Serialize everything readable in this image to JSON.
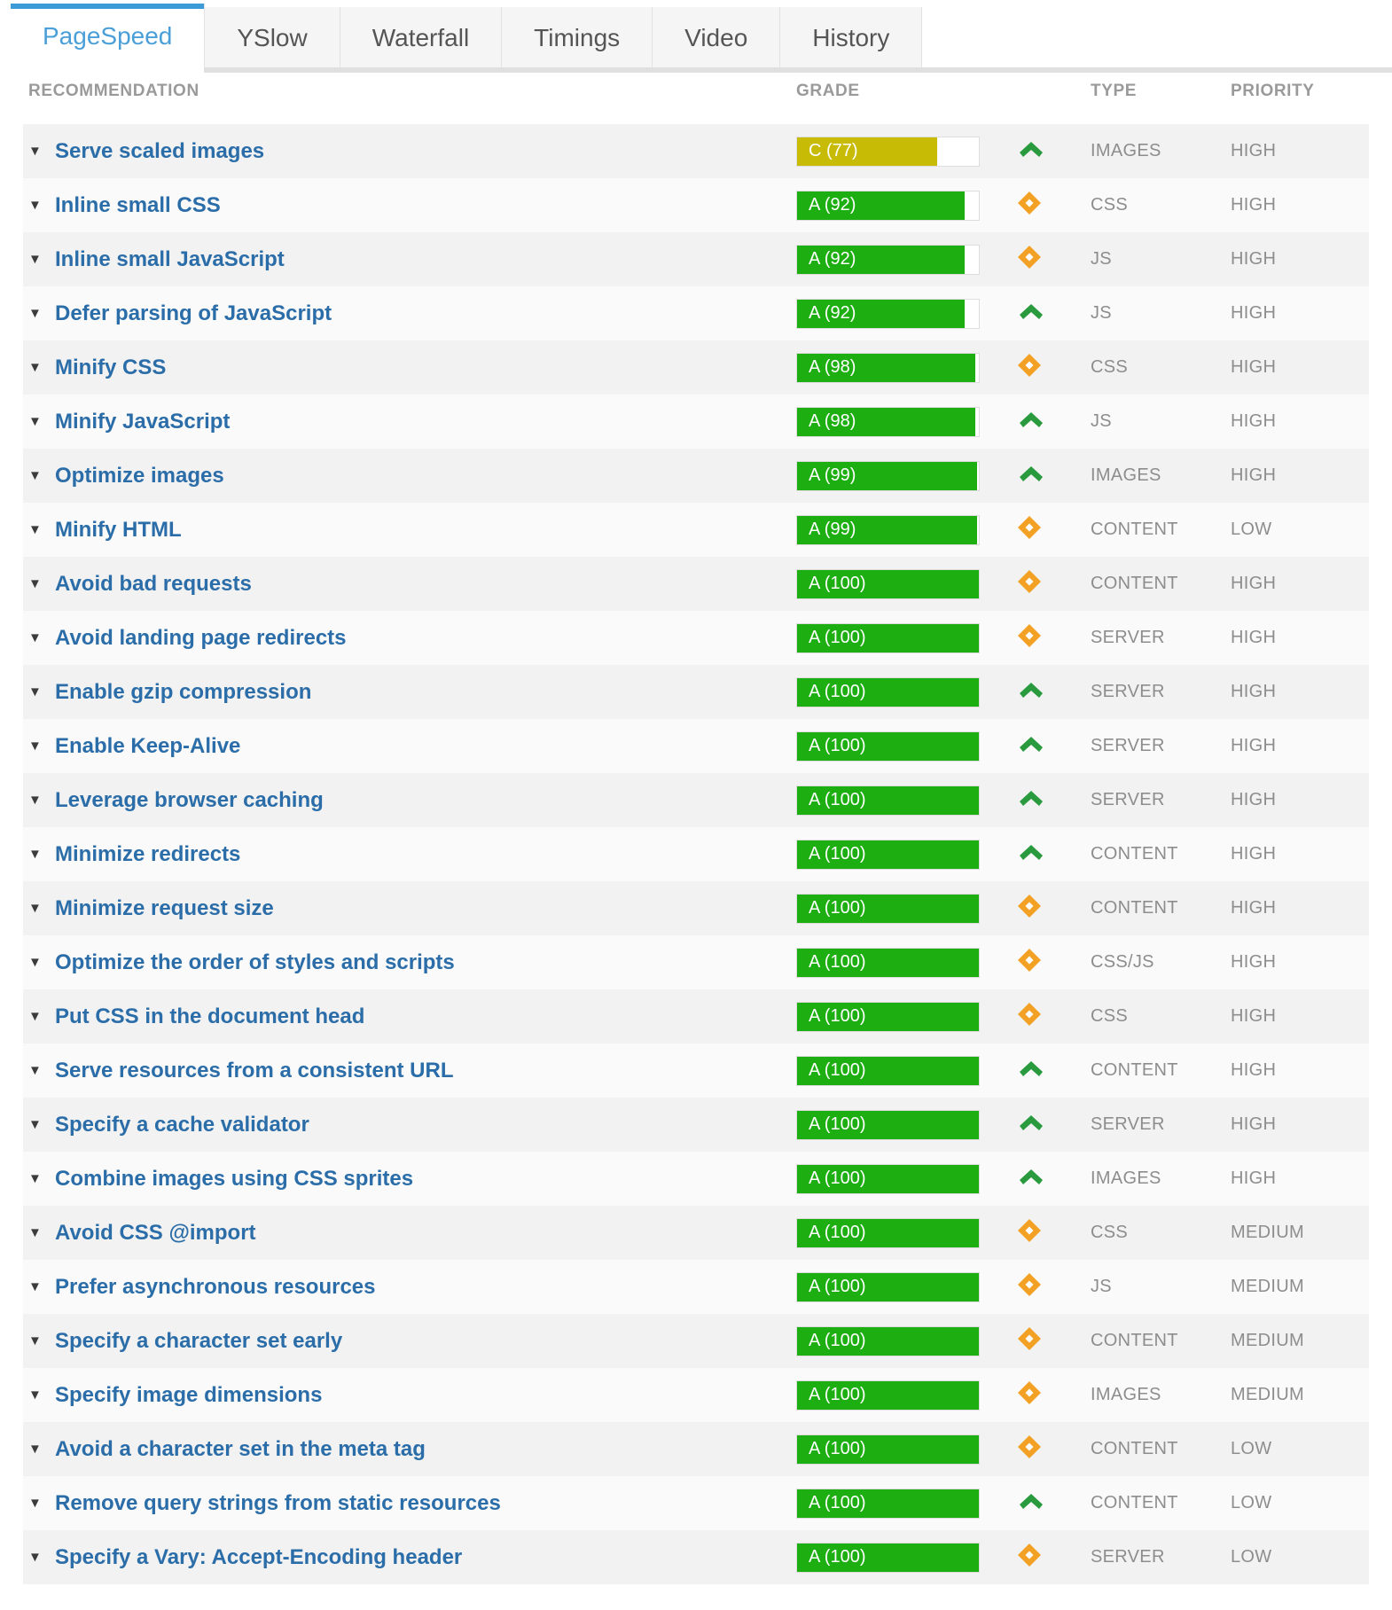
{
  "tabs": [
    {
      "label": "PageSpeed",
      "active": true
    },
    {
      "label": "YSlow",
      "active": false
    },
    {
      "label": "Waterfall",
      "active": false
    },
    {
      "label": "Timings",
      "active": false
    },
    {
      "label": "Video",
      "active": false
    },
    {
      "label": "History",
      "active": false
    }
  ],
  "columns": {
    "recommendation": "RECOMMENDATION",
    "grade": "GRADE",
    "type": "TYPE",
    "priority": "PRIORITY"
  },
  "colors": {
    "accent": "#3c9ad6",
    "link": "#2b6da8",
    "grade_green": "#1daf12",
    "grade_olive": "#c8bb06",
    "trend_up": "#2a9a3e",
    "trend_flat": "#f2a124",
    "header_text": "#9a9a9a",
    "row_odd": "#f2f2f2",
    "row_even": "#fafafa"
  },
  "toggle_glyph": "▼",
  "rows": [
    {
      "recommendation": "Serve scaled images",
      "grade": "C (77)",
      "score": 77,
      "grade_color": "olive",
      "trend": "up",
      "type": "IMAGES",
      "priority": "HIGH"
    },
    {
      "recommendation": "Inline small CSS",
      "grade": "A (92)",
      "score": 92,
      "grade_color": "green",
      "trend": "flat",
      "type": "CSS",
      "priority": "HIGH"
    },
    {
      "recommendation": "Inline small JavaScript",
      "grade": "A (92)",
      "score": 92,
      "grade_color": "green",
      "trend": "flat",
      "type": "JS",
      "priority": "HIGH"
    },
    {
      "recommendation": "Defer parsing of JavaScript",
      "grade": "A (92)",
      "score": 92,
      "grade_color": "green",
      "trend": "up",
      "type": "JS",
      "priority": "HIGH"
    },
    {
      "recommendation": "Minify CSS",
      "grade": "A (98)",
      "score": 98,
      "grade_color": "green",
      "trend": "flat",
      "type": "CSS",
      "priority": "HIGH"
    },
    {
      "recommendation": "Minify JavaScript",
      "grade": "A (98)",
      "score": 98,
      "grade_color": "green",
      "trend": "up",
      "type": "JS",
      "priority": "HIGH"
    },
    {
      "recommendation": "Optimize images",
      "grade": "A (99)",
      "score": 99,
      "grade_color": "green",
      "trend": "up",
      "type": "IMAGES",
      "priority": "HIGH"
    },
    {
      "recommendation": "Minify HTML",
      "grade": "A (99)",
      "score": 99,
      "grade_color": "green",
      "trend": "flat",
      "type": "CONTENT",
      "priority": "LOW"
    },
    {
      "recommendation": "Avoid bad requests",
      "grade": "A (100)",
      "score": 100,
      "grade_color": "green",
      "trend": "flat",
      "type": "CONTENT",
      "priority": "HIGH"
    },
    {
      "recommendation": "Avoid landing page redirects",
      "grade": "A (100)",
      "score": 100,
      "grade_color": "green",
      "trend": "flat",
      "type": "SERVER",
      "priority": "HIGH"
    },
    {
      "recommendation": "Enable gzip compression",
      "grade": "A (100)",
      "score": 100,
      "grade_color": "green",
      "trend": "up",
      "type": "SERVER",
      "priority": "HIGH"
    },
    {
      "recommendation": "Enable Keep-Alive",
      "grade": "A (100)",
      "score": 100,
      "grade_color": "green",
      "trend": "up",
      "type": "SERVER",
      "priority": "HIGH"
    },
    {
      "recommendation": "Leverage browser caching",
      "grade": "A (100)",
      "score": 100,
      "grade_color": "green",
      "trend": "up",
      "type": "SERVER",
      "priority": "HIGH"
    },
    {
      "recommendation": "Minimize redirects",
      "grade": "A (100)",
      "score": 100,
      "grade_color": "green",
      "trend": "up",
      "type": "CONTENT",
      "priority": "HIGH"
    },
    {
      "recommendation": "Minimize request size",
      "grade": "A (100)",
      "score": 100,
      "grade_color": "green",
      "trend": "flat",
      "type": "CONTENT",
      "priority": "HIGH"
    },
    {
      "recommendation": "Optimize the order of styles and scripts",
      "grade": "A (100)",
      "score": 100,
      "grade_color": "green",
      "trend": "flat",
      "type": "CSS/JS",
      "priority": "HIGH"
    },
    {
      "recommendation": "Put CSS in the document head",
      "grade": "A (100)",
      "score": 100,
      "grade_color": "green",
      "trend": "flat",
      "type": "CSS",
      "priority": "HIGH"
    },
    {
      "recommendation": "Serve resources from a consistent URL",
      "grade": "A (100)",
      "score": 100,
      "grade_color": "green",
      "trend": "up",
      "type": "CONTENT",
      "priority": "HIGH"
    },
    {
      "recommendation": "Specify a cache validator",
      "grade": "A (100)",
      "score": 100,
      "grade_color": "green",
      "trend": "up",
      "type": "SERVER",
      "priority": "HIGH"
    },
    {
      "recommendation": "Combine images using CSS sprites",
      "grade": "A (100)",
      "score": 100,
      "grade_color": "green",
      "trend": "up",
      "type": "IMAGES",
      "priority": "HIGH"
    },
    {
      "recommendation": "Avoid CSS @import",
      "grade": "A (100)",
      "score": 100,
      "grade_color": "green",
      "trend": "flat",
      "type": "CSS",
      "priority": "MEDIUM"
    },
    {
      "recommendation": "Prefer asynchronous resources",
      "grade": "A (100)",
      "score": 100,
      "grade_color": "green",
      "trend": "flat",
      "type": "JS",
      "priority": "MEDIUM"
    },
    {
      "recommendation": "Specify a character set early",
      "grade": "A (100)",
      "score": 100,
      "grade_color": "green",
      "trend": "flat",
      "type": "CONTENT",
      "priority": "MEDIUM"
    },
    {
      "recommendation": "Specify image dimensions",
      "grade": "A (100)",
      "score": 100,
      "grade_color": "green",
      "trend": "flat",
      "type": "IMAGES",
      "priority": "MEDIUM"
    },
    {
      "recommendation": "Avoid a character set in the meta tag",
      "grade": "A (100)",
      "score": 100,
      "grade_color": "green",
      "trend": "flat",
      "type": "CONTENT",
      "priority": "LOW"
    },
    {
      "recommendation": "Remove query strings from static resources",
      "grade": "A (100)",
      "score": 100,
      "grade_color": "green",
      "trend": "up",
      "type": "CONTENT",
      "priority": "LOW"
    },
    {
      "recommendation": "Specify a Vary: Accept-Encoding header",
      "grade": "A (100)",
      "score": 100,
      "grade_color": "green",
      "trend": "flat",
      "type": "SERVER",
      "priority": "LOW"
    }
  ]
}
